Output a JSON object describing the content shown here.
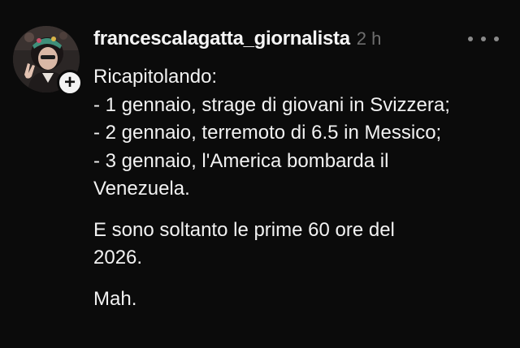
{
  "post": {
    "username": "francescalagatta_giornalista",
    "time_ago": "2 h",
    "more_icon": "more-horizontal-icon",
    "follow_icon": "plus-icon",
    "follow_symbol": "+",
    "paragraphs": [
      {
        "lines": [
          "Ricapitolando:",
          "- 1 gennaio, strage di giovani in Svizzera;",
          "- 2 gennaio, terremoto di 6.5 in Messico;",
          "- 3 gennaio, l'America bombarda il",
          "Venezuela."
        ]
      },
      {
        "lines": [
          "E sono soltanto le prime 60 ore del",
          "2026."
        ]
      },
      {
        "lines": [
          "Mah."
        ]
      }
    ]
  },
  "colors": {
    "background": "#0b0b0b",
    "text": "#f2f2f2",
    "timestamp": "#6e6e6e",
    "badge_bg": "#f4f4f4"
  }
}
